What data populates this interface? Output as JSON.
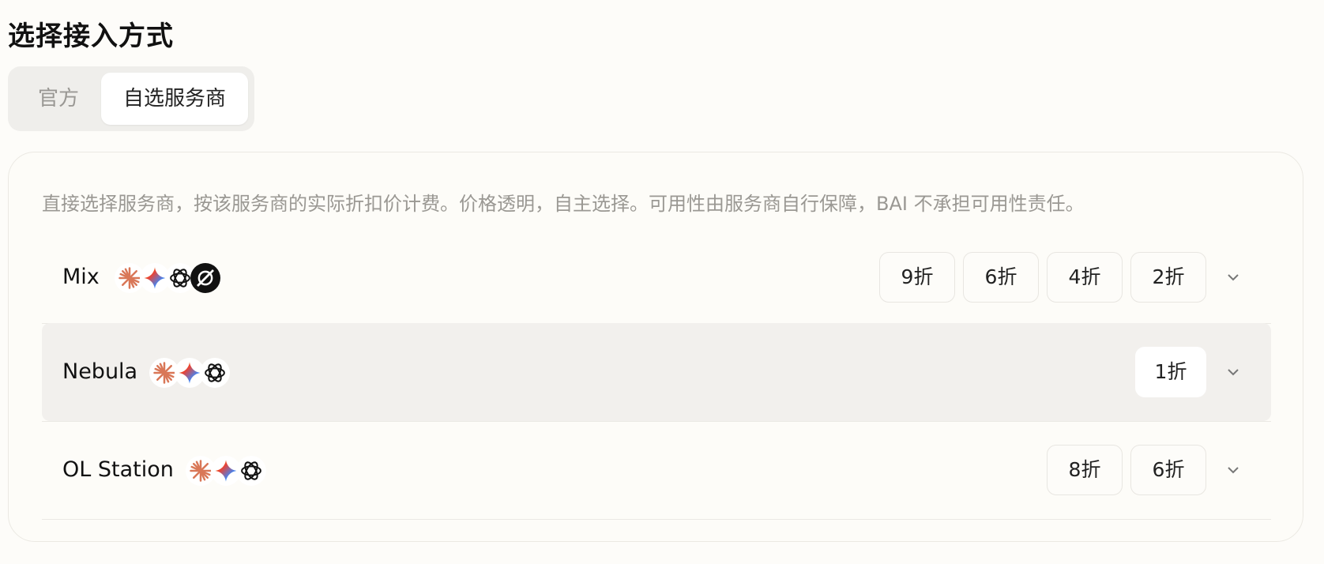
{
  "page": {
    "title": "选择接入方式"
  },
  "segment": {
    "options": [
      "官方",
      "自选服务商"
    ],
    "selected": "自选服务商"
  },
  "panel": {
    "description": "直接选择服务商，按该服务商的实际折扣价计费。价格透明，自主选择。可用性由服务商自行保障，BAI 不承担可用性责任。"
  },
  "providers": [
    {
      "name": "Mix",
      "icons": [
        "anthropic-icon",
        "gemini-icon",
        "openai-icon",
        "grok-icon"
      ],
      "discounts": [
        "9折",
        "6折",
        "4折",
        "2折"
      ],
      "highlighted": false
    },
    {
      "name": "Nebula",
      "icons": [
        "anthropic-icon",
        "gemini-icon",
        "openai-icon"
      ],
      "discounts": [
        "1折"
      ],
      "highlighted": true
    },
    {
      "name": "OL Station",
      "icons": [
        "anthropic-icon",
        "gemini-icon",
        "openai-icon"
      ],
      "discounts": [
        "8折",
        "6折"
      ],
      "highlighted": false
    }
  ],
  "colors": {
    "anthropic": "#d97757",
    "background": "#fdfcf9",
    "highlight": "#f2f0ed"
  }
}
